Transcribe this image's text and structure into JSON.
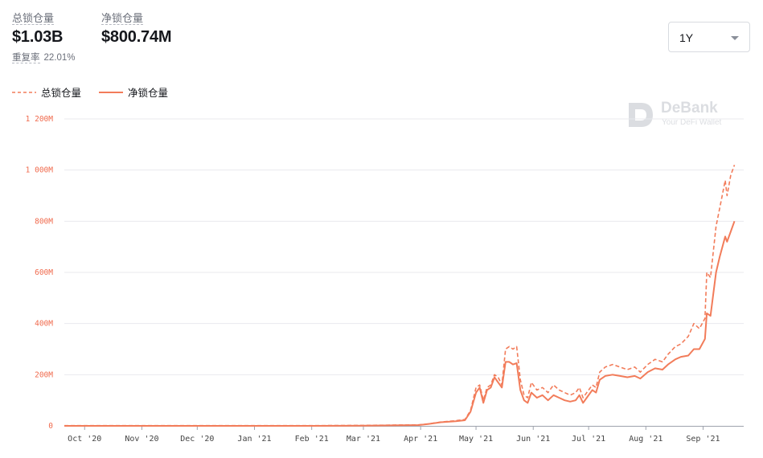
{
  "stats": {
    "tvl_label": "总锁仓量",
    "tvl_value": "$1.03B",
    "net_label": "净锁仓量",
    "net_value": "$800.74M",
    "ratio_label": "重复率",
    "ratio_value": "22.01%"
  },
  "range_select": {
    "value": "1Y"
  },
  "legend": {
    "tvl": "总锁仓量",
    "net": "净锁仓量"
  },
  "watermark": {
    "brand": "DeBank",
    "tagline": "Your DeFi Wallet"
  },
  "colors": {
    "series": "#f27c5a",
    "grid": "#e9eaee",
    "ytick": "#f06a4d"
  },
  "chart_data": {
    "type": "line",
    "title": "",
    "xlabel": "",
    "ylabel": "",
    "ylim": [
      0,
      1200
    ],
    "yticks": [
      0,
      200,
      400,
      600,
      800,
      1000,
      1200
    ],
    "ytick_labels": [
      "0",
      "200M",
      "400M",
      "600M",
      "800M",
      "1 000M",
      "1 200M"
    ],
    "xticks": [
      "Oct '20",
      "Nov '20",
      "Dec '20",
      "Jan '21",
      "Feb '21",
      "Mar '21",
      "Apr '21",
      "May '21",
      "Jun '21",
      "Jul '21",
      "Aug '21",
      "Sep '21"
    ],
    "x_domain": [
      "2020-09-20",
      "2021-09-23"
    ],
    "grid": true,
    "legend_position": "top-left",
    "series": [
      {
        "name": "总锁仓量",
        "style": "dashed",
        "points": [
          [
            "2020-09-20",
            1
          ],
          [
            "2020-10-01",
            1
          ],
          [
            "2020-11-01",
            1
          ],
          [
            "2020-12-01",
            1
          ],
          [
            "2021-01-01",
            1
          ],
          [
            "2021-02-01",
            1
          ],
          [
            "2021-03-01",
            2
          ],
          [
            "2021-03-31",
            4
          ],
          [
            "2021-04-05",
            8
          ],
          [
            "2021-04-12",
            15
          ],
          [
            "2021-04-20",
            20
          ],
          [
            "2021-04-25",
            25
          ],
          [
            "2021-04-28",
            60
          ],
          [
            "2021-05-01",
            150
          ],
          [
            "2021-05-03",
            160
          ],
          [
            "2021-05-05",
            100
          ],
          [
            "2021-05-07",
            150
          ],
          [
            "2021-05-09",
            160
          ],
          [
            "2021-05-11",
            200
          ],
          [
            "2021-05-13",
            190
          ],
          [
            "2021-05-15",
            160
          ],
          [
            "2021-05-17",
            300
          ],
          [
            "2021-05-19",
            310
          ],
          [
            "2021-05-21",
            300
          ],
          [
            "2021-05-23",
            310
          ],
          [
            "2021-05-25",
            180
          ],
          [
            "2021-05-27",
            120
          ],
          [
            "2021-05-29",
            110
          ],
          [
            "2021-05-31",
            170
          ],
          [
            "2021-06-03",
            140
          ],
          [
            "2021-06-06",
            150
          ],
          [
            "2021-06-09",
            130
          ],
          [
            "2021-06-12",
            160
          ],
          [
            "2021-06-15",
            140
          ],
          [
            "2021-06-18",
            130
          ],
          [
            "2021-06-21",
            120
          ],
          [
            "2021-06-24",
            130
          ],
          [
            "2021-06-26",
            150
          ],
          [
            "2021-06-28",
            110
          ],
          [
            "2021-06-30",
            130
          ],
          [
            "2021-07-03",
            160
          ],
          [
            "2021-07-05",
            150
          ],
          [
            "2021-07-07",
            210
          ],
          [
            "2021-07-10",
            230
          ],
          [
            "2021-07-14",
            240
          ],
          [
            "2021-07-18",
            230
          ],
          [
            "2021-07-22",
            220
          ],
          [
            "2021-07-26",
            230
          ],
          [
            "2021-07-29",
            210
          ],
          [
            "2021-08-02",
            240
          ],
          [
            "2021-08-06",
            260
          ],
          [
            "2021-08-10",
            250
          ],
          [
            "2021-08-13",
            280
          ],
          [
            "2021-08-17",
            310
          ],
          [
            "2021-08-20",
            320
          ],
          [
            "2021-08-24",
            350
          ],
          [
            "2021-08-27",
            400
          ],
          [
            "2021-08-30",
            380
          ],
          [
            "2021-09-02",
            420
          ],
          [
            "2021-09-03",
            600
          ],
          [
            "2021-09-05",
            580
          ],
          [
            "2021-09-08",
            780
          ],
          [
            "2021-09-10",
            850
          ],
          [
            "2021-09-13",
            960
          ],
          [
            "2021-09-14",
            900
          ],
          [
            "2021-09-16",
            980
          ],
          [
            "2021-09-18",
            1020
          ]
        ]
      },
      {
        "name": "净锁仓量",
        "style": "solid",
        "points": [
          [
            "2020-09-20",
            0
          ],
          [
            "2020-10-01",
            0
          ],
          [
            "2020-11-01",
            0
          ],
          [
            "2020-12-01",
            0
          ],
          [
            "2021-01-01",
            0
          ],
          [
            "2021-02-01",
            0
          ],
          [
            "2021-03-01",
            1
          ],
          [
            "2021-03-31",
            3
          ],
          [
            "2021-04-05",
            7
          ],
          [
            "2021-04-12",
            14
          ],
          [
            "2021-04-20",
            18
          ],
          [
            "2021-04-25",
            22
          ],
          [
            "2021-04-28",
            55
          ],
          [
            "2021-05-01",
            130
          ],
          [
            "2021-05-03",
            150
          ],
          [
            "2021-05-05",
            90
          ],
          [
            "2021-05-07",
            140
          ],
          [
            "2021-05-09",
            150
          ],
          [
            "2021-05-11",
            190
          ],
          [
            "2021-05-13",
            170
          ],
          [
            "2021-05-15",
            150
          ],
          [
            "2021-05-17",
            250
          ],
          [
            "2021-05-19",
            250
          ],
          [
            "2021-05-21",
            240
          ],
          [
            "2021-05-23",
            245
          ],
          [
            "2021-05-25",
            140
          ],
          [
            "2021-05-27",
            100
          ],
          [
            "2021-05-29",
            90
          ],
          [
            "2021-05-31",
            130
          ],
          [
            "2021-06-03",
            110
          ],
          [
            "2021-06-06",
            120
          ],
          [
            "2021-06-09",
            100
          ],
          [
            "2021-06-12",
            120
          ],
          [
            "2021-06-15",
            110
          ],
          [
            "2021-06-18",
            100
          ],
          [
            "2021-06-21",
            95
          ],
          [
            "2021-06-24",
            100
          ],
          [
            "2021-06-26",
            120
          ],
          [
            "2021-06-28",
            90
          ],
          [
            "2021-06-30",
            110
          ],
          [
            "2021-07-03",
            140
          ],
          [
            "2021-07-05",
            130
          ],
          [
            "2021-07-07",
            180
          ],
          [
            "2021-07-10",
            195
          ],
          [
            "2021-07-14",
            200
          ],
          [
            "2021-07-18",
            195
          ],
          [
            "2021-07-22",
            190
          ],
          [
            "2021-07-26",
            195
          ],
          [
            "2021-07-29",
            185
          ],
          [
            "2021-08-02",
            210
          ],
          [
            "2021-08-06",
            225
          ],
          [
            "2021-08-10",
            220
          ],
          [
            "2021-08-13",
            240
          ],
          [
            "2021-08-17",
            260
          ],
          [
            "2021-08-20",
            270
          ],
          [
            "2021-08-24",
            275
          ],
          [
            "2021-08-27",
            300
          ],
          [
            "2021-08-30",
            300
          ],
          [
            "2021-09-02",
            340
          ],
          [
            "2021-09-03",
            440
          ],
          [
            "2021-09-05",
            430
          ],
          [
            "2021-09-08",
            600
          ],
          [
            "2021-09-10",
            660
          ],
          [
            "2021-09-13",
            740
          ],
          [
            "2021-09-14",
            720
          ],
          [
            "2021-09-16",
            760
          ],
          [
            "2021-09-18",
            800
          ]
        ]
      }
    ]
  }
}
